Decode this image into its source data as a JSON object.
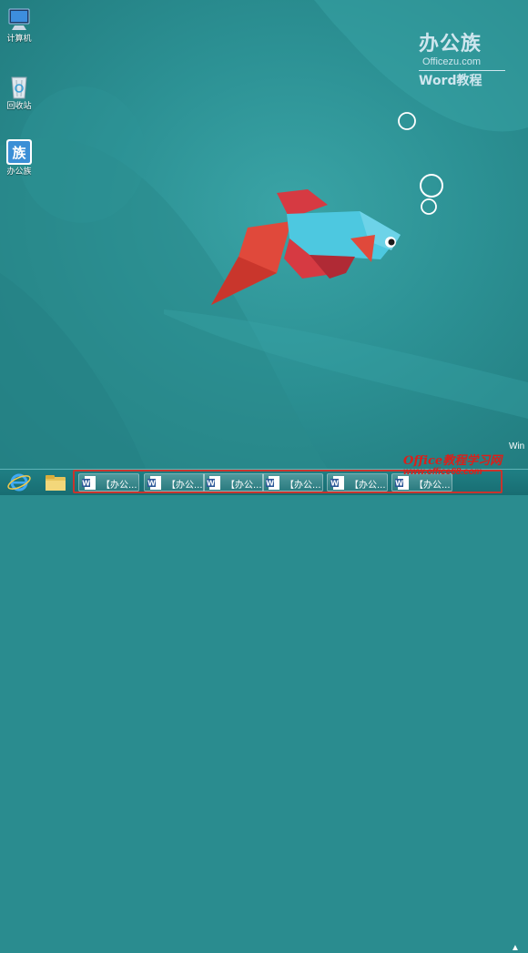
{
  "desktop_icons": [
    {
      "label": "计算机",
      "icon": "computer-icon"
    },
    {
      "label": "回收站",
      "icon": "recycle-bin-icon"
    },
    {
      "label": "办公族",
      "icon": "bangongzu-app-icon"
    }
  ],
  "watermark_logo": {
    "brand": "办公族",
    "url": "Officezu.com",
    "product": "Word教程"
  },
  "win_text": "Win",
  "taskbar": {
    "pinned": [
      {
        "name": "internet-explorer",
        "icon": "ie-icon"
      },
      {
        "name": "file-explorer",
        "icon": "folder-icon"
      }
    ],
    "word_windows": [
      {
        "label": "【办公..."
      },
      {
        "label": "【办公..."
      },
      {
        "label": "【办公..."
      },
      {
        "label": "【办公..."
      },
      {
        "label": "【办公..."
      },
      {
        "label": "【办公..."
      }
    ],
    "tray_arrow": "▲"
  },
  "site_watermark": {
    "line1": "Office教程学习网",
    "line2": "www.office68.com"
  },
  "colors": {
    "wallpaper": "#2c9194",
    "taskbar": "#1a7378",
    "highlight_box": "#c8342d"
  }
}
